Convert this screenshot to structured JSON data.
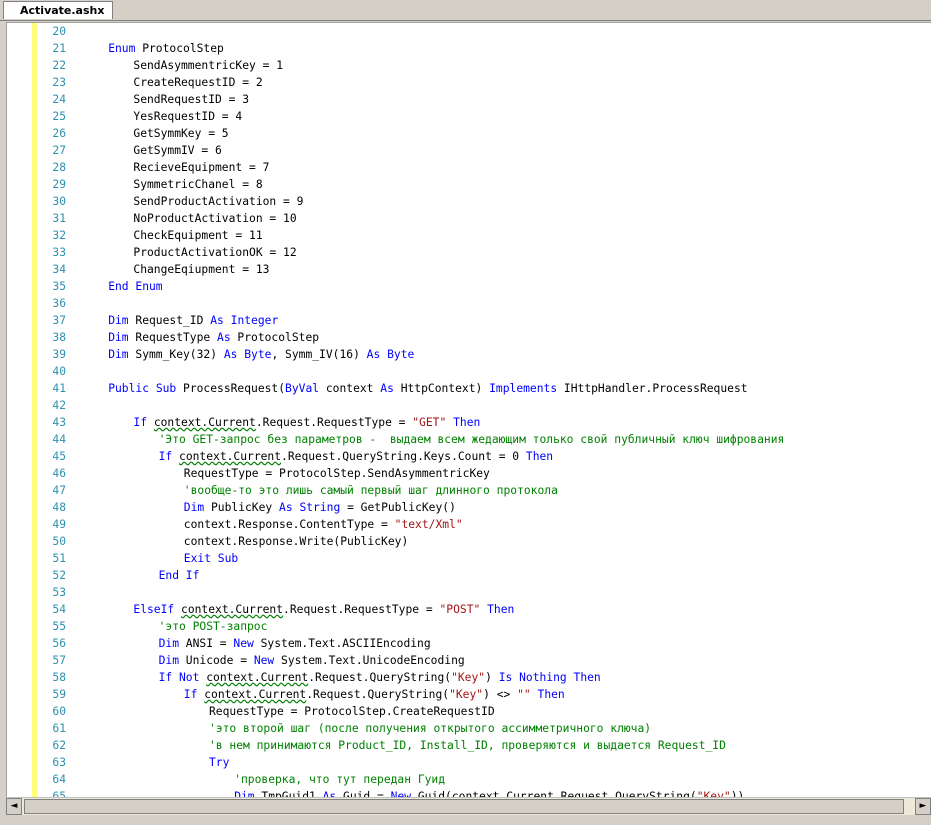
{
  "tab": {
    "title": "Activate.ashx"
  },
  "lines": [
    {
      "n": "20",
      "indent": 0,
      "tokens": []
    },
    {
      "n": "21",
      "indent": 1,
      "tokens": [
        {
          "t": "Enum",
          "c": "kw"
        },
        {
          "t": " ProtocolStep"
        }
      ]
    },
    {
      "n": "22",
      "indent": 2,
      "tokens": [
        {
          "t": "SendAsymmentricKey = 1"
        }
      ]
    },
    {
      "n": "23",
      "indent": 2,
      "tokens": [
        {
          "t": "CreateRequestID = 2"
        }
      ]
    },
    {
      "n": "24",
      "indent": 2,
      "tokens": [
        {
          "t": "SendRequestID = 3"
        }
      ]
    },
    {
      "n": "25",
      "indent": 2,
      "tokens": [
        {
          "t": "YesRequestID = 4"
        }
      ]
    },
    {
      "n": "26",
      "indent": 2,
      "tokens": [
        {
          "t": "GetSymmKey = 5"
        }
      ]
    },
    {
      "n": "27",
      "indent": 2,
      "tokens": [
        {
          "t": "GetSymmIV = 6"
        }
      ]
    },
    {
      "n": "28",
      "indent": 2,
      "tokens": [
        {
          "t": "RecieveEquipment = 7"
        }
      ]
    },
    {
      "n": "29",
      "indent": 2,
      "tokens": [
        {
          "t": "SymmetricChanel = 8"
        }
      ]
    },
    {
      "n": "30",
      "indent": 2,
      "tokens": [
        {
          "t": "SendProductActivation = 9"
        }
      ]
    },
    {
      "n": "31",
      "indent": 2,
      "tokens": [
        {
          "t": "NoProductActivation = 10"
        }
      ]
    },
    {
      "n": "32",
      "indent": 2,
      "tokens": [
        {
          "t": "CheckEquipment = 11"
        }
      ]
    },
    {
      "n": "33",
      "indent": 2,
      "tokens": [
        {
          "t": "ProductActivationOK = 12"
        }
      ]
    },
    {
      "n": "34",
      "indent": 2,
      "tokens": [
        {
          "t": "ChangeEqiupment = 13"
        }
      ]
    },
    {
      "n": "35",
      "indent": 1,
      "tokens": [
        {
          "t": "End Enum",
          "c": "kw"
        }
      ]
    },
    {
      "n": "36",
      "indent": 0,
      "tokens": []
    },
    {
      "n": "37",
      "indent": 1,
      "tokens": [
        {
          "t": "Dim",
          "c": "kw"
        },
        {
          "t": " Request_ID "
        },
        {
          "t": "As",
          "c": "kw"
        },
        {
          "t": " "
        },
        {
          "t": "Integer",
          "c": "kw"
        }
      ]
    },
    {
      "n": "38",
      "indent": 1,
      "tokens": [
        {
          "t": "Dim",
          "c": "kw"
        },
        {
          "t": " RequestType "
        },
        {
          "t": "As",
          "c": "kw"
        },
        {
          "t": " ProtocolStep"
        }
      ]
    },
    {
      "n": "39",
      "indent": 1,
      "tokens": [
        {
          "t": "Dim",
          "c": "kw"
        },
        {
          "t": " Symm_Key(32) "
        },
        {
          "t": "As",
          "c": "kw"
        },
        {
          "t": " "
        },
        {
          "t": "Byte",
          "c": "kw"
        },
        {
          "t": ", Symm_IV(16) "
        },
        {
          "t": "As",
          "c": "kw"
        },
        {
          "t": " "
        },
        {
          "t": "Byte",
          "c": "kw"
        }
      ]
    },
    {
      "n": "40",
      "indent": 0,
      "tokens": []
    },
    {
      "n": "41",
      "indent": 1,
      "tokens": [
        {
          "t": "Public",
          "c": "kw"
        },
        {
          "t": " "
        },
        {
          "t": "Sub",
          "c": "kw"
        },
        {
          "t": " ProcessRequest("
        },
        {
          "t": "ByVal",
          "c": "kw"
        },
        {
          "t": " context "
        },
        {
          "t": "As",
          "c": "kw"
        },
        {
          "t": " HttpContext) "
        },
        {
          "t": "Implements",
          "c": "kw"
        },
        {
          "t": " IHttpHandler.ProcessRequest"
        }
      ]
    },
    {
      "n": "42",
      "indent": 0,
      "tokens": []
    },
    {
      "n": "43",
      "indent": 2,
      "tokens": [
        {
          "t": "If",
          "c": "kw"
        },
        {
          "t": " "
        },
        {
          "t": "context.Current",
          "c": "sq"
        },
        {
          "t": ".Request.RequestType = "
        },
        {
          "t": "\"GET\"",
          "c": "str"
        },
        {
          "t": " "
        },
        {
          "t": "Then",
          "c": "kw"
        }
      ]
    },
    {
      "n": "44",
      "indent": 3,
      "tokens": [
        {
          "t": "'Это GET-запрос без параметров -  выдаем всем жедающим только свой публичный ключ шифрования",
          "c": "cm"
        }
      ]
    },
    {
      "n": "45",
      "indent": 3,
      "tokens": [
        {
          "t": "If",
          "c": "kw"
        },
        {
          "t": " "
        },
        {
          "t": "context.Current",
          "c": "sq"
        },
        {
          "t": ".Request.QueryString.Keys.Count = 0 "
        },
        {
          "t": "Then",
          "c": "kw"
        }
      ]
    },
    {
      "n": "46",
      "indent": 4,
      "tokens": [
        {
          "t": "RequestType = ProtocolStep.SendAsymmentricKey"
        }
      ]
    },
    {
      "n": "47",
      "indent": 4,
      "tokens": [
        {
          "t": "'вообще-то это лишь самый первый шаг длинного протокола",
          "c": "cm"
        }
      ]
    },
    {
      "n": "48",
      "indent": 4,
      "tokens": [
        {
          "t": "Dim",
          "c": "kw"
        },
        {
          "t": " PublicKey "
        },
        {
          "t": "As",
          "c": "kw"
        },
        {
          "t": " "
        },
        {
          "t": "String",
          "c": "kw"
        },
        {
          "t": " = GetPublicKey()"
        }
      ]
    },
    {
      "n": "49",
      "indent": 4,
      "tokens": [
        {
          "t": "context.Response.ContentType = "
        },
        {
          "t": "\"text/Xml\"",
          "c": "str"
        }
      ]
    },
    {
      "n": "50",
      "indent": 4,
      "tokens": [
        {
          "t": "context.Response.Write(PublicKey)"
        }
      ]
    },
    {
      "n": "51",
      "indent": 4,
      "tokens": [
        {
          "t": "Exit Sub",
          "c": "kw"
        }
      ]
    },
    {
      "n": "52",
      "indent": 3,
      "tokens": [
        {
          "t": "End If",
          "c": "kw"
        }
      ]
    },
    {
      "n": "53",
      "indent": 0,
      "tokens": []
    },
    {
      "n": "54",
      "indent": 2,
      "tokens": [
        {
          "t": "ElseIf",
          "c": "kw"
        },
        {
          "t": " "
        },
        {
          "t": "context.Current",
          "c": "sq"
        },
        {
          "t": ".Request.RequestType = "
        },
        {
          "t": "\"POST\"",
          "c": "str"
        },
        {
          "t": " "
        },
        {
          "t": "Then",
          "c": "kw"
        }
      ]
    },
    {
      "n": "55",
      "indent": 3,
      "tokens": [
        {
          "t": "'это POST-запрос",
          "c": "cm"
        }
      ]
    },
    {
      "n": "56",
      "indent": 3,
      "tokens": [
        {
          "t": "Dim",
          "c": "kw"
        },
        {
          "t": " ANSI = "
        },
        {
          "t": "New",
          "c": "kw"
        },
        {
          "t": " System.Text.ASCIIEncoding"
        }
      ]
    },
    {
      "n": "57",
      "indent": 3,
      "tokens": [
        {
          "t": "Dim",
          "c": "kw"
        },
        {
          "t": " Unicode = "
        },
        {
          "t": "New",
          "c": "kw"
        },
        {
          "t": " System.Text.UnicodeEncoding"
        }
      ]
    },
    {
      "n": "58",
      "indent": 3,
      "tokens": [
        {
          "t": "If Not",
          "c": "kw"
        },
        {
          "t": " "
        },
        {
          "t": "context.Current",
          "c": "sq"
        },
        {
          "t": ".Request.QueryString("
        },
        {
          "t": "\"Key\"",
          "c": "str"
        },
        {
          "t": ") "
        },
        {
          "t": "Is Nothing Then",
          "c": "kw"
        }
      ]
    },
    {
      "n": "59",
      "indent": 4,
      "tokens": [
        {
          "t": "If",
          "c": "kw"
        },
        {
          "t": " "
        },
        {
          "t": "context.Current",
          "c": "sq"
        },
        {
          "t": ".Request.QueryString("
        },
        {
          "t": "\"Key\"",
          "c": "str"
        },
        {
          "t": ") <> "
        },
        {
          "t": "\"\"",
          "c": "str"
        },
        {
          "t": " "
        },
        {
          "t": "Then",
          "c": "kw"
        }
      ]
    },
    {
      "n": "60",
      "indent": 5,
      "tokens": [
        {
          "t": "RequestType = ProtocolStep.CreateRequestID"
        }
      ]
    },
    {
      "n": "61",
      "indent": 5,
      "tokens": [
        {
          "t": "'это второй шаг (после получения открытого ассимметричного ключа)",
          "c": "cm"
        }
      ]
    },
    {
      "n": "62",
      "indent": 5,
      "tokens": [
        {
          "t": "'в нем принимаются Product_ID, Install_ID, проверяются и выдается Request_ID",
          "c": "cm"
        }
      ]
    },
    {
      "n": "63",
      "indent": 5,
      "tokens": [
        {
          "t": "Try",
          "c": "kw"
        }
      ]
    },
    {
      "n": "64",
      "indent": 6,
      "tokens": [
        {
          "t": "'проверка, что тут передан Гуид",
          "c": "cm"
        }
      ]
    },
    {
      "n": "65",
      "indent": 6,
      "tokens": [
        {
          "t": "Dim",
          "c": "kw"
        },
        {
          "t": " TmpGuid1 "
        },
        {
          "t": "As",
          "c": "kw"
        },
        {
          "t": " Guid = "
        },
        {
          "t": "New",
          "c": "kw"
        },
        {
          "t": " Guid(context.Current.Request.QueryString("
        },
        {
          "t": "\"Key\"",
          "c": "str"
        },
        {
          "t": "))"
        }
      ]
    }
  ]
}
